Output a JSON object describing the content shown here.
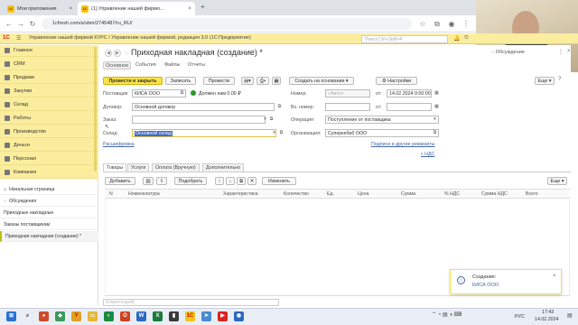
{
  "browser": {
    "tabs": [
      {
        "label": "Мои приложения",
        "favicon": "1С"
      },
      {
        "label": "(1) Управление нашей фирмо…",
        "favicon": "1С"
      }
    ],
    "url": "1cfresh.com/a/sbm/2745487/ru_RU/"
  },
  "app": {
    "logo": "1С",
    "title": "Управление нашей фирмой КУРС / Управление нашей фирмой, редакция 3.0  (1С:Предприятие)",
    "search_placeholder": "Поиск Ctrl+Shift+F"
  },
  "sidebar": {
    "items": [
      {
        "label": "Главное",
        "icon": "menu-icon"
      },
      {
        "label": "CRM",
        "icon": "crm-icon"
      },
      {
        "label": "Продажи",
        "icon": "sales-icon"
      },
      {
        "label": "Закупки",
        "icon": "purchase-icon"
      },
      {
        "label": "Склад",
        "icon": "warehouse-icon"
      },
      {
        "label": "Работы",
        "icon": "works-icon"
      },
      {
        "label": "Производство",
        "icon": "production-icon"
      },
      {
        "label": "Деньги",
        "icon": "money-icon"
      },
      {
        "label": "Персонал",
        "icon": "staff-icon"
      },
      {
        "label": "Компания",
        "icon": "company-icon"
      }
    ]
  },
  "open_windows": [
    "Начальная страница",
    "Обсуждения",
    "Приходные накладные",
    "Заказы поставщикам",
    "Приходная накладная (создание) *"
  ],
  "form": {
    "title": "Приходная накладная (создание) *",
    "tabs": [
      "Основное",
      "События",
      "Файлы",
      "Отчеты"
    ],
    "toolbar": {
      "post_close": "Провести и закрыть",
      "save": "Записать",
      "post": "Провести",
      "create_basis": "Создать на основании",
      "settings": "Настройки",
      "more": "Еще"
    },
    "fields": {
      "supplier_label": "Поставщик:",
      "supplier_value": "КИСА ООО",
      "debt_text": "Должен нам 0.00 ₽",
      "number_label": "Номер:",
      "number_placeholder": "<Авто>",
      "date_label": "от:",
      "date_value": "14.02.2024  0:00:00",
      "contract_label": "Договор:",
      "contract_value": "Основной договор",
      "in_number_label": "Вх. номер:",
      "in_date_label": "от:",
      "order_label": "Заказ:",
      "operation_label": "Операция:",
      "operation_value": "Поступление от поставщика",
      "warehouse_label": "Склад:",
      "warehouse_value": "Основной склад",
      "organization_label": "Организация:",
      "organization_value": "Суперкебаб ООО",
      "detailing_link": "Расшифровка",
      "signatures_link": "Подписи и другие реквизиты",
      "vat_link": "с НДС"
    },
    "inner_tabs": [
      "Товары",
      "Услуги",
      "Оплата (Вручную)",
      "Дополнительно"
    ],
    "table_toolbar": {
      "add": "Добавить",
      "pick": "Подобрать",
      "change": "Изменить",
      "more": "Еще"
    },
    "table_columns": [
      "N",
      "Номенклатура",
      "Характеристика",
      "Количество",
      "Ед.",
      "Цена",
      "Сумма",
      "% НДС",
      "Сумма НДС",
      "Всего"
    ],
    "comment_placeholder": "Комментарий"
  },
  "notification": {
    "title": "Создание:",
    "link": "КИСА ООО"
  },
  "discussions_label": "Обсуждение",
  "taskbar": {
    "lang": "РУС",
    "time": "17:43",
    "date": "14.02.2024"
  },
  "colors": {
    "accent": "#fbe24a",
    "sidebar": "#fbed9e",
    "link": "#4466aa"
  }
}
